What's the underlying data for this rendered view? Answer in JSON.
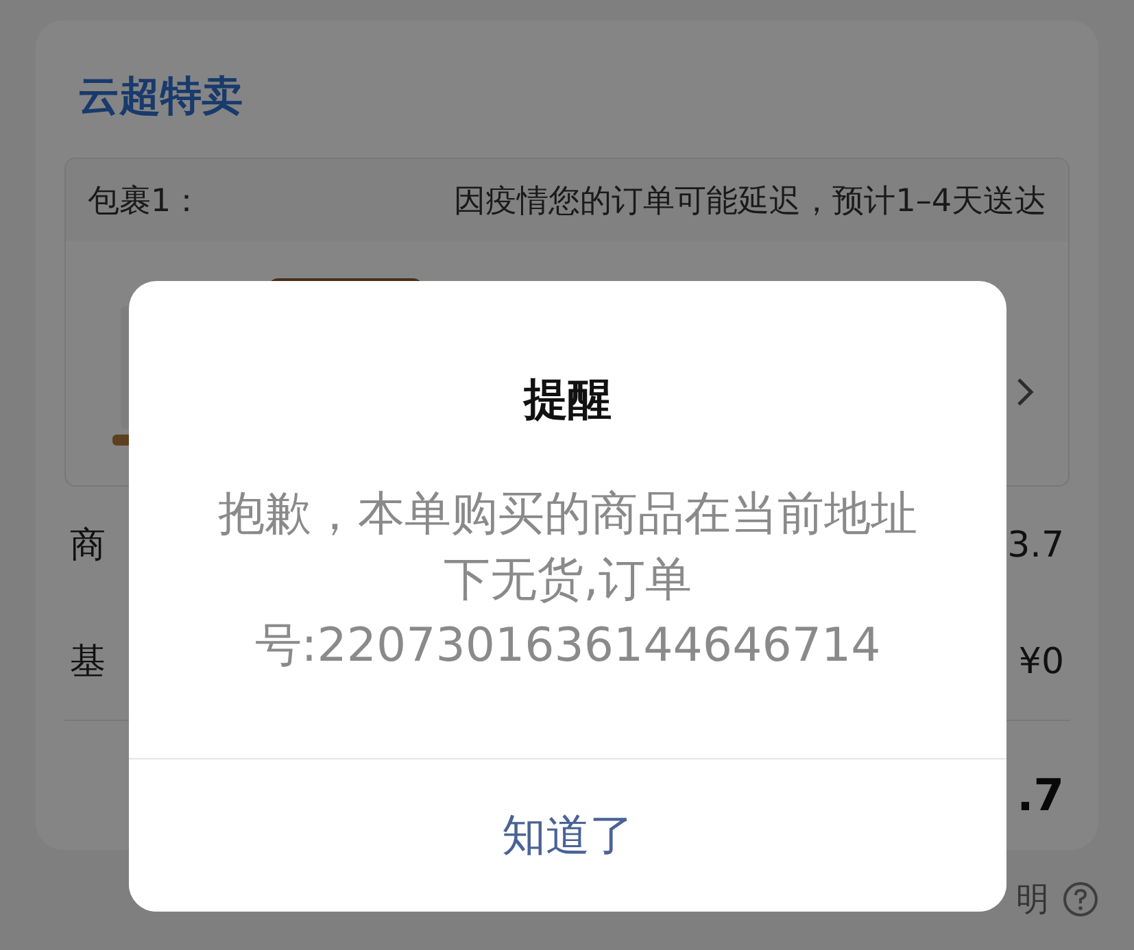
{
  "page": {
    "title": "云超特卖",
    "package": {
      "label": "包裹1：",
      "notice": "因疫情您的订单可能延迟，预计1–4天送达"
    },
    "rows": [
      {
        "label": "商",
        "value": "3.7"
      },
      {
        "label": "基",
        "value": "¥0"
      }
    ],
    "total": ".7",
    "discount_link": "明"
  },
  "dialog": {
    "title": "提醒",
    "message": "抱歉，本单购买的商品在当前地址下无货,订单号:2207301636144646714",
    "button": "知道了"
  }
}
